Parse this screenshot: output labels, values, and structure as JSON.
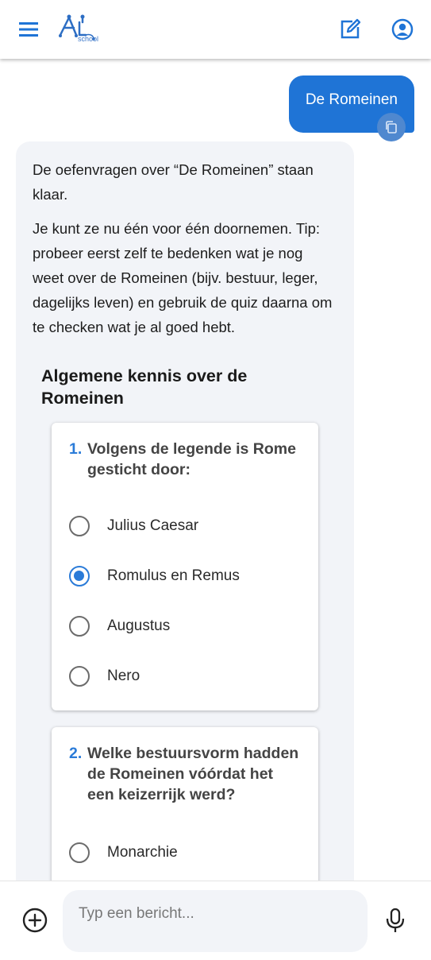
{
  "header": {
    "logo_text": "school",
    "menu_icon": "hamburger-menu-icon",
    "edit_icon": "edit-note-icon",
    "profile_icon": "account-circle-icon",
    "accent_color": "#1f74d6"
  },
  "user_message": {
    "text": "De Romeinen"
  },
  "assistant_message": {
    "paragraphs": [
      "De oefenvragen over “De Romeinen” staan klaar.",
      "Je kunt ze nu één voor één doornemen. Tip: probeer eerst zelf te bedenken wat je nog weet over de Romeinen (bijv. bestuur, leger, dagelijks leven) en gebruik de quiz daarna om te checken wat je al goed hebt."
    ],
    "quiz": {
      "title": "Algemene kennis over de Romeinen",
      "questions": [
        {
          "number": "1.",
          "text": "Volgens de legende is Rome gesticht door:",
          "options": [
            "Julius Caesar",
            "Romulus en Remus",
            "Augustus",
            "Nero"
          ],
          "selected": "Romulus en Remus"
        },
        {
          "number": "2.",
          "text": "Welke bestuursvorm hadden de Romeinen vóórdat het een keizerrijk werd?",
          "options": [
            "Monarchie"
          ],
          "selected": ""
        }
      ]
    }
  },
  "composer": {
    "placeholder": "Typ een bericht...",
    "value": ""
  }
}
